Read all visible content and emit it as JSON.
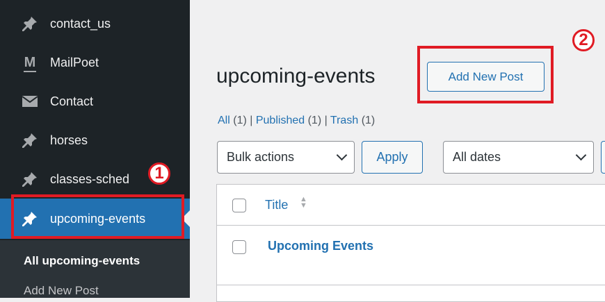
{
  "sidebar": {
    "items": [
      {
        "label": "contact_us",
        "icon": "pin-icon"
      },
      {
        "label": "MailPoet",
        "icon": "mailpoet-icon"
      },
      {
        "label": "Contact",
        "icon": "envelope-icon"
      },
      {
        "label": "horses",
        "icon": "pin-icon"
      },
      {
        "label": "classes-sched",
        "icon": "pin-icon"
      },
      {
        "label": "upcoming-events",
        "icon": "pin-icon",
        "active": true
      }
    ],
    "submenu": [
      {
        "label": "All upcoming-events",
        "current": true
      },
      {
        "label": "Add New Post"
      }
    ],
    "mailpoet_letter": "M"
  },
  "annotations": {
    "one": "1",
    "two": "2"
  },
  "main": {
    "page_title": "upcoming-events",
    "add_new_label": "Add New Post",
    "filters": {
      "all": "All",
      "all_count": "(1)",
      "published": "Published",
      "published_count": "(1)",
      "trash": "Trash",
      "trash_count": "(1)",
      "sep": "|"
    },
    "bulk_actions": "Bulk actions",
    "apply_label": "Apply",
    "all_dates": "All dates",
    "table": {
      "col_title": "Title",
      "rows": [
        {
          "title": "Upcoming Events"
        }
      ]
    }
  },
  "colors": {
    "accent": "#2271b1",
    "sidebar_bg": "#1d2327",
    "annotation": "#e01b24"
  }
}
